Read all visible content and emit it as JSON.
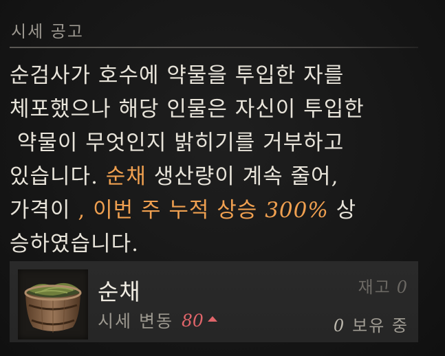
{
  "header": {
    "title": "시세 공고"
  },
  "message": {
    "line1": "순검사가 호수에 약물을 투입한 자를",
    "line2": "체포했으나 해당 인물은 자신이 투입한",
    "line3": " 약물이 무엇인지 밝히기를 거부하고",
    "line4_a": "있습니다. ",
    "line4_hl": "순채",
    "line4_b": " 생산량이 계속 줄어,",
    "line5_a": "가격이 ",
    "line5_hl": ", 이번 주 누적 상승 ",
    "line5_pct": "300%",
    "line5_b": " 상",
    "line6": "승하였습니다."
  },
  "item": {
    "name": "순채",
    "price_label": "시세 변동",
    "price_change": "80",
    "stock_label": "재고",
    "stock_value": "0",
    "owned_value": "0",
    "owned_label": "보유 중",
    "icon": "basket-of-water-shield-icon"
  },
  "colors": {
    "highlight": "#f0a050",
    "price_up": "#e0656a"
  }
}
